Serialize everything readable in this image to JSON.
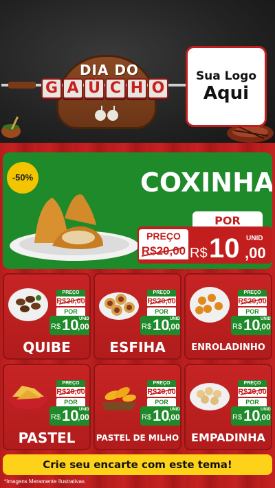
{
  "header": {
    "badge": {
      "line1": "DIA DO",
      "line2_letters": [
        "G",
        "A",
        "Ú",
        "C",
        "H",
        "O"
      ]
    },
    "logo": {
      "line1": "Sua Logo",
      "line2": "Aqui"
    }
  },
  "colors": {
    "brand_red": "#c21e1e",
    "brand_green": "#1e8a2a",
    "accent_yellow": "#ffd21a"
  },
  "hero": {
    "discount": "-50%",
    "title": "COXINHA",
    "preco_label": "PREÇO",
    "old_price": "R$20,00",
    "por_label": "POR",
    "currency": "R$",
    "price_int": "10",
    "price_cents": ",00",
    "unit": "UNID"
  },
  "products": [
    {
      "name": "QUIBE",
      "preco_label": "PREÇO",
      "old_price": "R$20,00",
      "por_label": "POR",
      "currency": "R$",
      "price_int": "10",
      "price_cents": ",00",
      "unit": "UNID",
      "icon": "quibe-icon"
    },
    {
      "name": "ESFIHA",
      "preco_label": "PREÇO",
      "old_price": "R$20,00",
      "por_label": "POR",
      "currency": "R$",
      "price_int": "10",
      "price_cents": ",00",
      "unit": "UNID",
      "icon": "esfiha-icon"
    },
    {
      "name": "ENROLADINHO",
      "preco_label": "PREÇO",
      "old_price": "R$20,00",
      "por_label": "POR",
      "currency": "R$",
      "price_int": "10",
      "price_cents": ",00",
      "unit": "UNID",
      "icon": "enroladinho-icon"
    },
    {
      "name": "PASTEL",
      "preco_label": "PREÇO",
      "old_price": "R$20,00",
      "por_label": "POR",
      "currency": "R$",
      "price_int": "10",
      "price_cents": ",00",
      "unit": "UNID",
      "icon": "pastel-icon"
    },
    {
      "name": "PASTEL DE MILHO",
      "preco_label": "PREÇO",
      "old_price": "R$20,00",
      "por_label": "POR",
      "currency": "R$",
      "price_int": "10",
      "price_cents": ",00",
      "unit": "UNID",
      "icon": "pastel-de-milho-icon"
    },
    {
      "name": "EMPADINHA",
      "preco_label": "PREÇO",
      "old_price": "R$20,00",
      "por_label": "POR",
      "currency": "R$",
      "price_int": "10",
      "price_cents": ",00",
      "unit": "UNID",
      "icon": "empadinha-icon"
    }
  ],
  "footer": {
    "cta": "Crie seu encarte com este tema!",
    "disclaimer": "*Imagens Meramente Ilustrativas"
  }
}
